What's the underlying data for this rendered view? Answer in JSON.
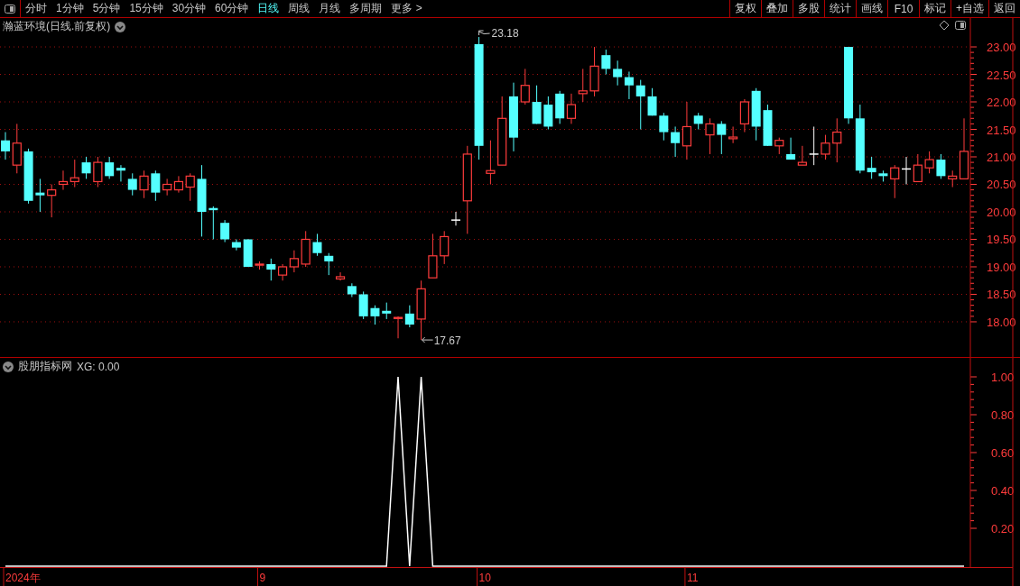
{
  "toolbar": {
    "tabs": [
      {
        "label": "分时",
        "selected": false
      },
      {
        "label": "1分钟",
        "selected": false
      },
      {
        "label": "5分钟",
        "selected": false
      },
      {
        "label": "15分钟",
        "selected": false
      },
      {
        "label": "30分钟",
        "selected": false
      },
      {
        "label": "60分钟",
        "selected": false
      },
      {
        "label": "日线",
        "selected": true
      },
      {
        "label": "周线",
        "selected": false
      },
      {
        "label": "月线",
        "selected": false
      },
      {
        "label": "多周期",
        "selected": false
      },
      {
        "label": "更多 >",
        "selected": false
      }
    ],
    "buttons": [
      "复权",
      "叠加",
      "多股",
      "统计",
      "画线",
      "F10",
      "标记",
      "+自选",
      "返回"
    ]
  },
  "price_panel": {
    "title": "瀚蓝环境(日线.前复权)",
    "high_marker": "23.18",
    "low_marker": "17.67",
    "chart_data": {
      "type": "candlestick",
      "grid": true,
      "ylim": [
        17.36,
        23.525
      ],
      "yticks": [
        {
          "value": 23,
          "label": "23.00"
        },
        {
          "value": 22.5,
          "label": "22.50"
        },
        {
          "value": 22,
          "label": "22.00"
        },
        {
          "value": 21.5,
          "label": "21.50"
        },
        {
          "value": 21,
          "label": "21.00"
        },
        {
          "value": 20.5,
          "label": "20.50"
        },
        {
          "value": 20,
          "label": "20.00"
        },
        {
          "value": 19.5,
          "label": "19.50"
        },
        {
          "value": 19,
          "label": "19.00"
        },
        {
          "value": 18.5,
          "label": "18.50"
        },
        {
          "value": 18,
          "label": "18.00"
        }
      ],
      "ohlc": [
        [
          21.3,
          21.45,
          20.95,
          21.1
        ],
        [
          20.85,
          21.6,
          20.7,
          21.25
        ],
        [
          21.1,
          21.15,
          20.15,
          20.2
        ],
        [
          20.35,
          20.6,
          20.0,
          20.3
        ],
        [
          20.3,
          20.5,
          19.9,
          20.4
        ],
        [
          20.5,
          20.75,
          20.4,
          20.55
        ],
        [
          20.55,
          20.95,
          20.45,
          20.62
        ],
        [
          20.9,
          21.0,
          20.6,
          20.7
        ],
        [
          20.55,
          21.0,
          20.45,
          20.9
        ],
        [
          20.9,
          21.0,
          20.6,
          20.65
        ],
        [
          20.8,
          20.85,
          20.55,
          20.75
        ],
        [
          20.6,
          20.7,
          20.3,
          20.4
        ],
        [
          20.4,
          20.75,
          20.25,
          20.65
        ],
        [
          20.7,
          20.75,
          20.2,
          20.35
        ],
        [
          20.4,
          20.6,
          20.3,
          20.5
        ],
        [
          20.4,
          20.65,
          20.35,
          20.55
        ],
        [
          20.45,
          20.7,
          20.2,
          20.65
        ],
        [
          20.6,
          20.85,
          19.55,
          20.0
        ],
        [
          20.07,
          20.1,
          19.5,
          20.03
        ],
        [
          19.8,
          19.85,
          19.45,
          19.5
        ],
        [
          19.45,
          19.5,
          19.3,
          19.35
        ],
        [
          19.5,
          19.5,
          19.0,
          19.0
        ],
        [
          19.03,
          19.1,
          18.95,
          19.05
        ],
        [
          19.05,
          19.15,
          18.75,
          18.95
        ],
        [
          18.85,
          19.05,
          18.75,
          19.0
        ],
        [
          19.0,
          19.3,
          18.9,
          19.15
        ],
        [
          19.05,
          19.65,
          19.0,
          19.5
        ],
        [
          19.45,
          19.6,
          19.2,
          19.25
        ],
        [
          19.2,
          19.25,
          18.85,
          19.1
        ],
        [
          18.78,
          18.9,
          18.75,
          18.82
        ],
        [
          18.65,
          18.7,
          18.45,
          18.5
        ],
        [
          18.5,
          18.55,
          18.05,
          18.1
        ],
        [
          18.25,
          18.3,
          17.95,
          18.1
        ],
        [
          18.2,
          18.35,
          18.05,
          18.15
        ],
        [
          18.06,
          18.1,
          17.7,
          18.08
        ],
        [
          18.15,
          18.3,
          17.9,
          17.95
        ],
        [
          18.05,
          18.75,
          17.67,
          18.6
        ],
        [
          18.8,
          19.6,
          18.8,
          19.2
        ],
        [
          19.2,
          19.65,
          19.05,
          19.55
        ],
        [
          19.85,
          20.0,
          19.75,
          19.85
        ],
        [
          20.2,
          21.2,
          19.6,
          21.05
        ],
        [
          23.05,
          23.18,
          20.95,
          21.2
        ],
        [
          20.7,
          21.3,
          20.5,
          20.75
        ],
        [
          20.85,
          22.1,
          20.85,
          21.7
        ],
        [
          22.1,
          22.35,
          21.1,
          21.35
        ],
        [
          22.0,
          22.6,
          21.95,
          22.3
        ],
        [
          22.0,
          22.3,
          21.6,
          21.6
        ],
        [
          21.95,
          22.1,
          21.5,
          21.55
        ],
        [
          22.15,
          22.2,
          21.6,
          21.7
        ],
        [
          21.7,
          22.15,
          21.6,
          21.95
        ],
        [
          22.15,
          22.6,
          22.0,
          22.2
        ],
        [
          22.2,
          23.0,
          22.1,
          22.65
        ],
        [
          22.85,
          22.95,
          22.5,
          22.6
        ],
        [
          22.6,
          22.75,
          22.3,
          22.45
        ],
        [
          22.45,
          22.55,
          22.05,
          22.3
        ],
        [
          22.3,
          22.4,
          21.5,
          22.1
        ],
        [
          22.1,
          22.25,
          21.75,
          21.75
        ],
        [
          21.75,
          21.8,
          21.3,
          21.45
        ],
        [
          21.45,
          21.55,
          21.0,
          21.25
        ],
        [
          21.2,
          22.0,
          20.95,
          21.55
        ],
        [
          21.75,
          21.8,
          21.5,
          21.6
        ],
        [
          21.4,
          21.7,
          21.05,
          21.6
        ],
        [
          21.6,
          21.65,
          21.05,
          21.4
        ],
        [
          21.33,
          21.55,
          21.25,
          21.36
        ],
        [
          21.6,
          22.05,
          21.45,
          22.0
        ],
        [
          22.2,
          22.25,
          21.3,
          21.55
        ],
        [
          21.85,
          21.95,
          21.2,
          21.2
        ],
        [
          21.2,
          21.35,
          21.05,
          21.3
        ],
        [
          21.05,
          21.35,
          20.95,
          20.95
        ],
        [
          20.85,
          21.2,
          20.85,
          20.9
        ],
        [
          21.05,
          21.55,
          20.85,
          21.05
        ],
        [
          21.05,
          21.4,
          20.95,
          21.25
        ],
        [
          21.25,
          21.7,
          20.9,
          21.45
        ],
        [
          23.0,
          23.0,
          21.6,
          21.7
        ],
        [
          21.7,
          21.95,
          20.7,
          20.75
        ],
        [
          20.8,
          21.0,
          20.6,
          20.72
        ],
        [
          20.7,
          20.75,
          20.55,
          20.65
        ],
        [
          20.6,
          20.85,
          20.25,
          20.8
        ],
        [
          20.78,
          21.0,
          20.5,
          20.78
        ],
        [
          20.55,
          21.05,
          20.55,
          20.85
        ],
        [
          20.8,
          21.1,
          20.7,
          20.95
        ],
        [
          20.95,
          21.05,
          20.6,
          20.65
        ],
        [
          20.6,
          20.75,
          20.45,
          20.65
        ],
        [
          20.6,
          21.7,
          20.6,
          21.1
        ]
      ]
    }
  },
  "indicator_panel": {
    "title": "股朋指标网",
    "reading": "XG: 0.00",
    "date_labels": [
      "2024年",
      "9",
      "10",
      "11"
    ],
    "chart_data": {
      "type": "line",
      "ylim": [
        0,
        1.1
      ],
      "yticks": [
        {
          "value": 1,
          "label": "1.00"
        },
        {
          "value": 0.8,
          "label": "0.80"
        },
        {
          "value": 0.6,
          "label": "0.60"
        },
        {
          "value": 0.4,
          "label": "0.40"
        },
        {
          "value": 0.2,
          "label": "0.20"
        }
      ],
      "series": [
        {
          "color": "#ffffff",
          "values": [
            0,
            0,
            0,
            0,
            0,
            0,
            0,
            0,
            0,
            0,
            0,
            0,
            0,
            0,
            0,
            0,
            0,
            0,
            0,
            0,
            0,
            0,
            0,
            0,
            0,
            0,
            0,
            0,
            0,
            0,
            0,
            0,
            0,
            0,
            1,
            0,
            1,
            0,
            0,
            0,
            0,
            0,
            0,
            0,
            0,
            0,
            0,
            0,
            0,
            0,
            0,
            0,
            0,
            0,
            0,
            0,
            0,
            0,
            0,
            0,
            0,
            0,
            0,
            0,
            0,
            0,
            0,
            0,
            0,
            0,
            0,
            0,
            0,
            0,
            0,
            0,
            0,
            0,
            0,
            0,
            0,
            0,
            0,
            0
          ]
        }
      ]
    }
  }
}
